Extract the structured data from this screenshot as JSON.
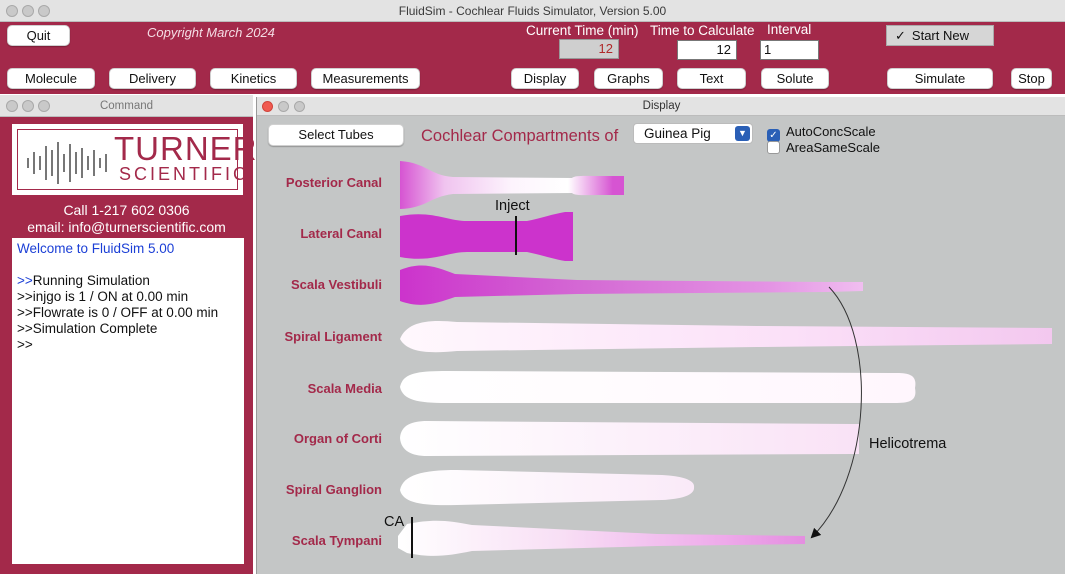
{
  "window": {
    "title": "FluidSim - Cochlear Fluids Simulator, Version 5.00"
  },
  "toolbar": {
    "quit": "Quit",
    "copyright": "Copyright March 2024",
    "current_time_label": "Current Time (min)",
    "current_time_value": "12",
    "time_to_calc_label": "Time to Calculate",
    "time_to_calc_value": "12",
    "interval_label": "Interval",
    "interval_value": "1",
    "start_new": "Start New",
    "start_new_checked": true,
    "molecule": "Molecule",
    "delivery": "Delivery",
    "kinetics": "Kinetics",
    "measurements": "Measurements",
    "display": "Display",
    "graphs": "Graphs",
    "text": "Text",
    "solute": "Solute",
    "simulate": "Simulate",
    "stop": "Stop"
  },
  "command": {
    "title": "Command",
    "logo_word1": "TURNER",
    "logo_word2": "SCIENTIFIC",
    "call": "Call 1-217 602 0306",
    "email": "email: info@turnerscientific.com",
    "welcome": "Welcome to FluidSim 5.00",
    "lines": [
      {
        "prompt": ">>",
        "text": "Running Simulation"
      },
      {
        "prompt": ">>",
        "text": "injgo is 1 / ON at 0.00 min"
      },
      {
        "prompt": ">>",
        "text": "Flowrate is 0 / OFF at 0.00 min"
      },
      {
        "prompt": ">>",
        "text": "Simulation Complete"
      },
      {
        "prompt": ">>",
        "text": ""
      }
    ]
  },
  "display": {
    "title": "Display",
    "select_tubes": "Select Tubes",
    "compartments_title": "Cochlear Compartments of",
    "species": "Guinea Pig",
    "auto_conc_scale": "AutoConcScale",
    "auto_conc_scale_checked": true,
    "area_same_scale": "AreaSameScale",
    "area_same_scale_checked": false,
    "tubes": [
      {
        "label": "Posterior Canal"
      },
      {
        "label": "Lateral Canal"
      },
      {
        "label": "Scala Vestibuli"
      },
      {
        "label": "Spiral Ligament"
      },
      {
        "label": "Scala Media"
      },
      {
        "label": "Organ of Corti"
      },
      {
        "label": "Spiral Ganglion"
      },
      {
        "label": "Scala Tympani"
      }
    ],
    "annotations": {
      "inject": "Inject",
      "helicotrema": "Helicotrema",
      "ca": "CA"
    },
    "colors": {
      "brand": "#a3294a",
      "tracer": "#cc33cc"
    }
  }
}
